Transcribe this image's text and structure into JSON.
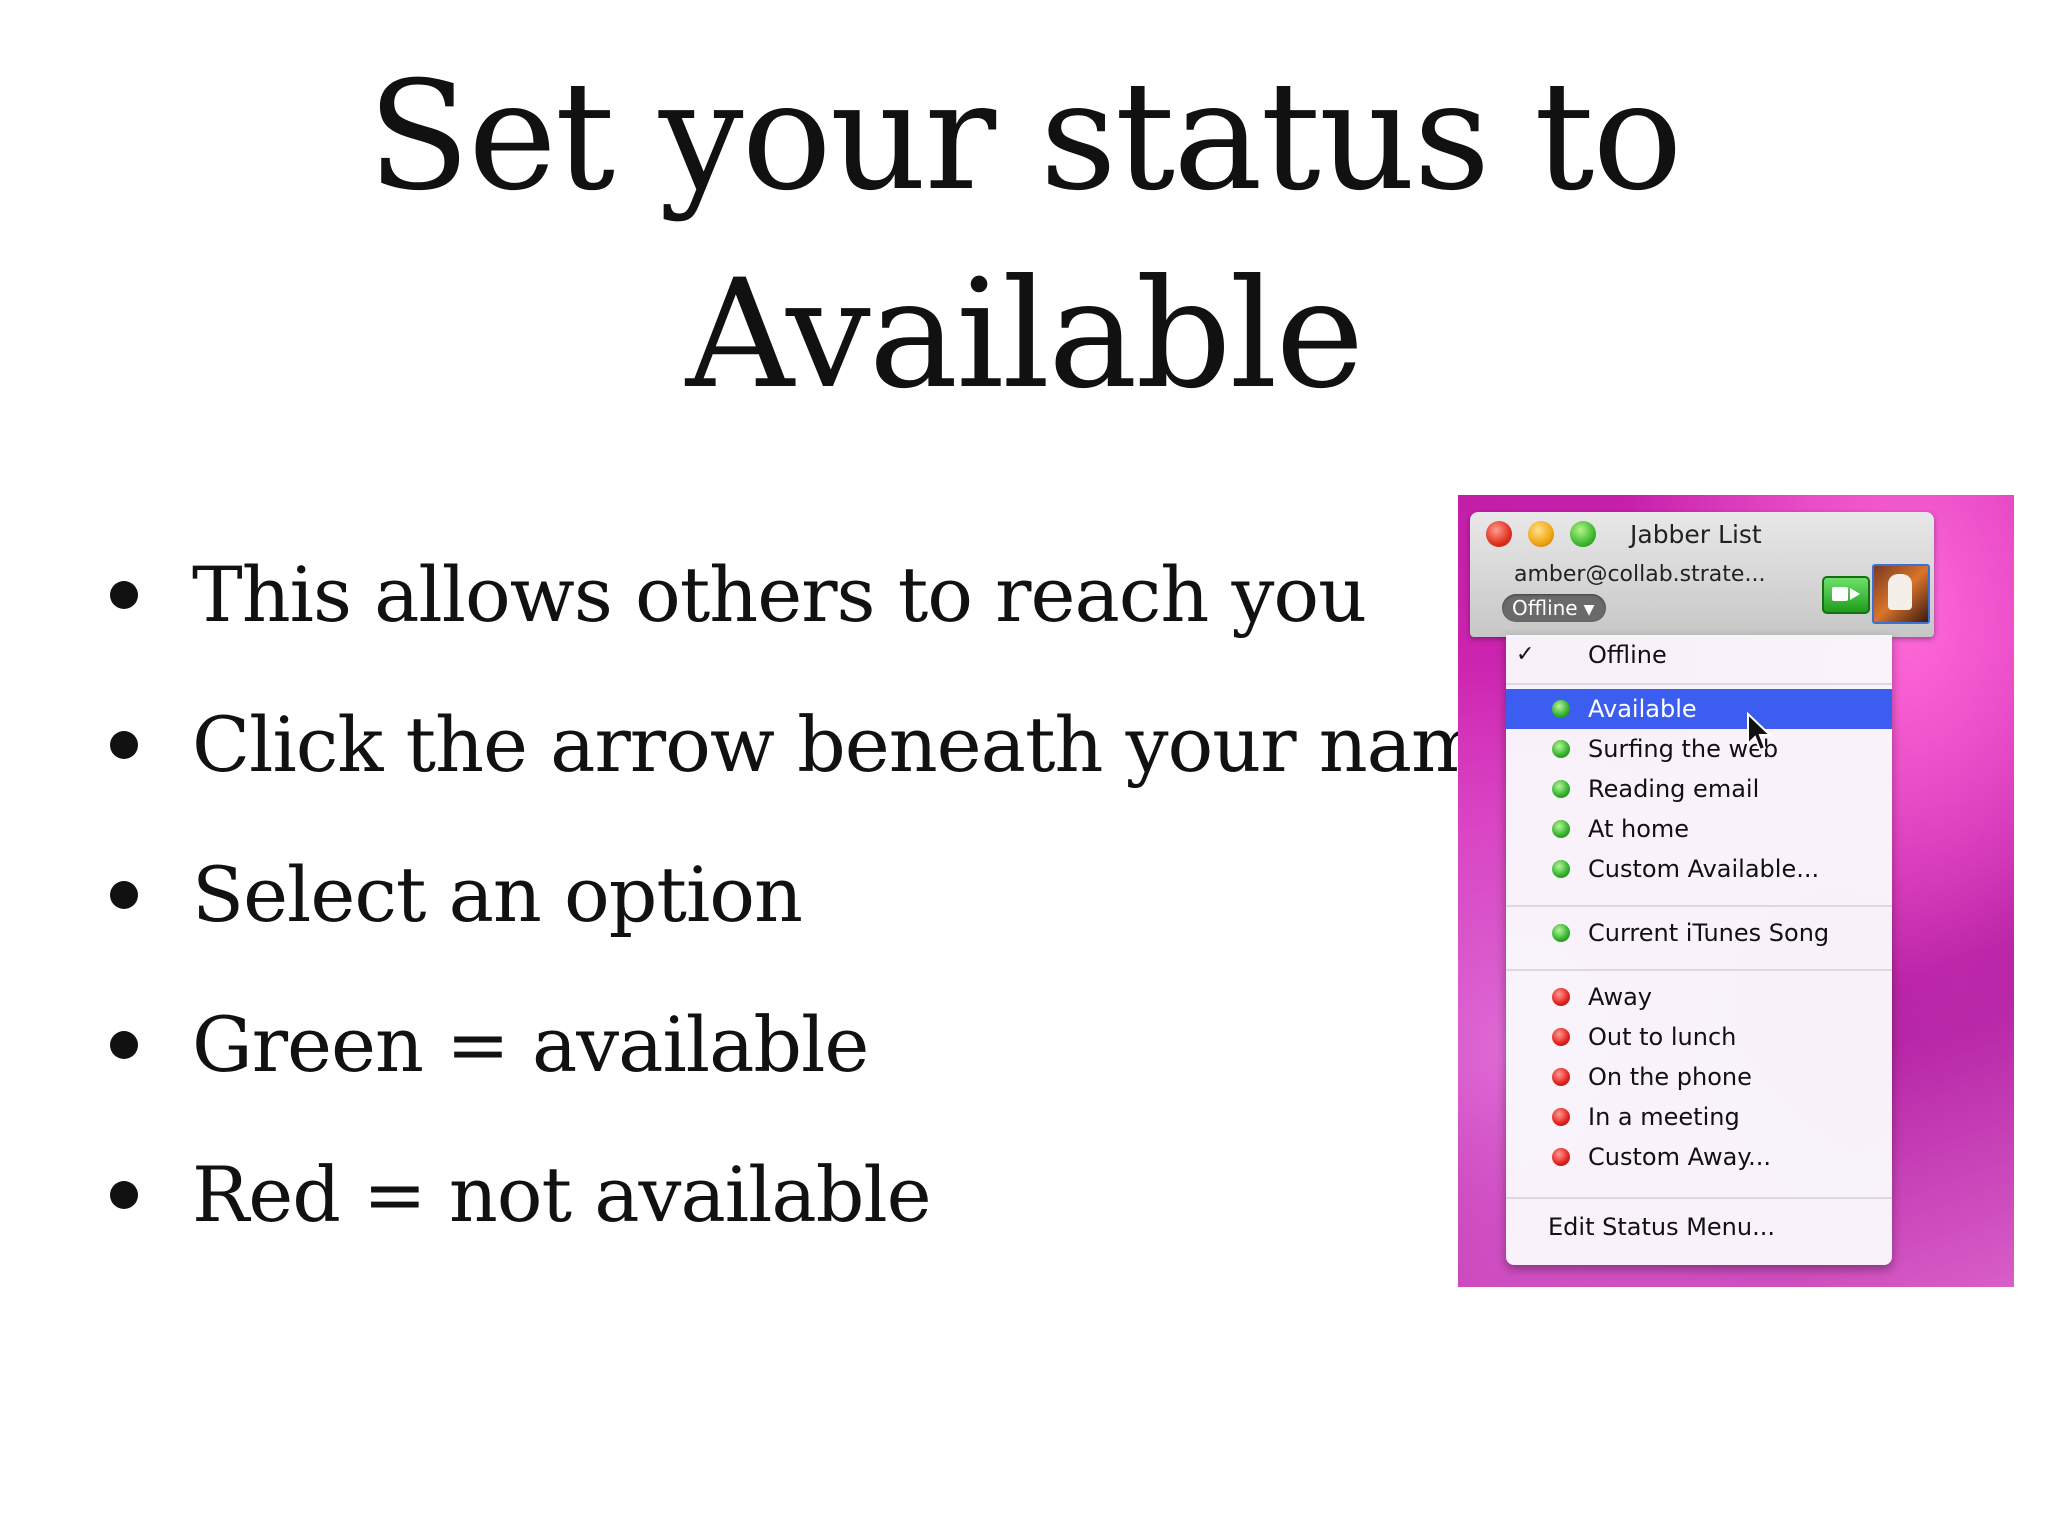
{
  "title": {
    "line1": "Set your status to",
    "line2": "Available"
  },
  "bullets": [
    "This allows others to reach you",
    "Click the arrow beneath your name",
    "Select an option",
    "Green = available",
    "Red = not available"
  ],
  "screenshot": {
    "window_title": "Jabber List",
    "account": "amber@collab.strate...",
    "status_button": "Offline",
    "menu": {
      "current": "Offline",
      "available_items": [
        "Available",
        "Surfing the web",
        "Reading email",
        "At home",
        "Custom Available..."
      ],
      "itunes_item": "Current iTunes Song",
      "away_items": [
        "Away",
        "Out to lunch",
        "On the phone",
        "In a meeting",
        "Custom Away..."
      ],
      "edit_item": "Edit Status Menu..."
    },
    "colors": {
      "available": "#2eae2a",
      "away": "#e01f1a",
      "selection": "#3b5df0",
      "background": "#c21ea8"
    }
  }
}
